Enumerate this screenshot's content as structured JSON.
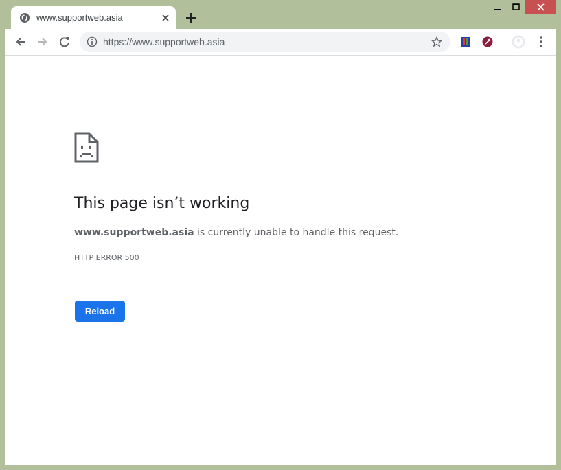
{
  "tab": {
    "title": "www.supportweb.asia",
    "favicon": "globe-icon"
  },
  "window_controls": [
    "minimize-icon",
    "maximize-icon",
    "close-icon"
  ],
  "toolbar": {
    "url": "https://www.supportweb.asia",
    "icons": [
      "back-arrow-icon",
      "forward-arrow-icon",
      "reload-icon",
      "info-icon",
      "star-icon",
      "extension-icon",
      "extension-icon",
      "profile-icon",
      "menu-icon"
    ]
  },
  "error": {
    "title": "This page isn’t working",
    "domain": "www.supportweb.asia",
    "message": " is currently unable to handle this request.",
    "code": "HTTP ERROR 500",
    "reload_label": "Reload"
  },
  "colors": {
    "frame": "#b1c09b",
    "close_button": "#c75050",
    "reload_button": "#1a73e8"
  }
}
